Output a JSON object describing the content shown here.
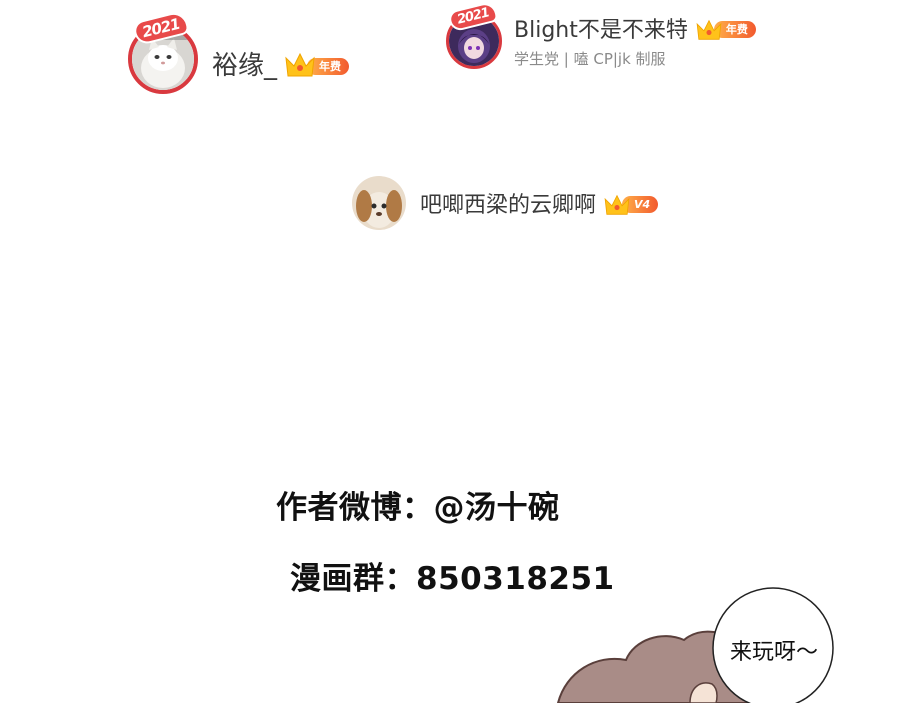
{
  "users": [
    {
      "name": "裕缘_",
      "subtitle": "",
      "frame_label": "2021",
      "badge_label": "年费",
      "avatar_icon": "cat-avatar-icon"
    },
    {
      "name": "Blight不是不来特",
      "subtitle": "学生党 | 嗑 CP|jk 制服",
      "frame_label": "2021",
      "badge_label": "年费",
      "avatar_icon": "anime-character-avatar-icon"
    },
    {
      "name": "吧唧西梁的云卿啊",
      "subtitle": "",
      "frame_label": "",
      "badge_label": "V4",
      "avatar_icon": "dog-avatar-icon"
    }
  ],
  "credits": {
    "author_line": "作者微博：@汤十碗",
    "group_line": "漫画群：850318251"
  },
  "speech_bubble": {
    "text": "来玩呀～"
  },
  "colors": {
    "badge_gradient_start": "#ffb04a",
    "badge_gradient_end": "#f25a2e",
    "crown": "#ffc21a",
    "frame_red": "#d9393f",
    "character_fill": "#a98c87",
    "text_dark": "#111111"
  }
}
